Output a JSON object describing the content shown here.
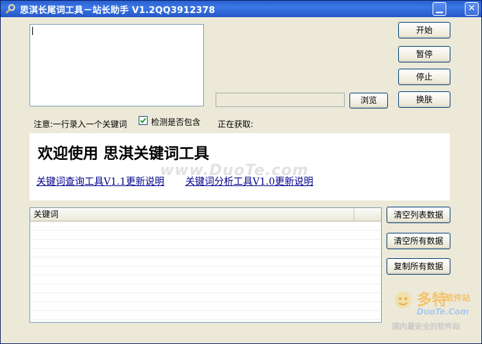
{
  "window": {
    "title": "思淇长尾词工具－站长助手 V1.2QQ3912378",
    "minimize": "▁",
    "close": "✕"
  },
  "buttons": {
    "start": "开始",
    "pause": "暂停",
    "stop": "停止",
    "skin": "换肤",
    "browse": "浏览"
  },
  "options": {
    "note": "注意:一行录入一个关键词",
    "check_label": "检测是否包含",
    "check_checked": true,
    "fetching": "正在获取:"
  },
  "welcome": {
    "title": "欢迎使用  思淇关键词工具",
    "watermark": "www.DuoTe.com",
    "link1": "关键词查询工具V1.1更新说明",
    "link2": "关键词分析工具V1.0更新说明"
  },
  "list": {
    "column_keyword": "关键词"
  },
  "list_actions": {
    "clear_list": "清空列表数据",
    "clear_all": "清空所有数据",
    "copy_all": "复制所有数据"
  },
  "logo": {
    "name": "多特",
    "soft": "软件站",
    "site": "DuoTe.Com",
    "tagline": "国内最安全的软件站"
  }
}
